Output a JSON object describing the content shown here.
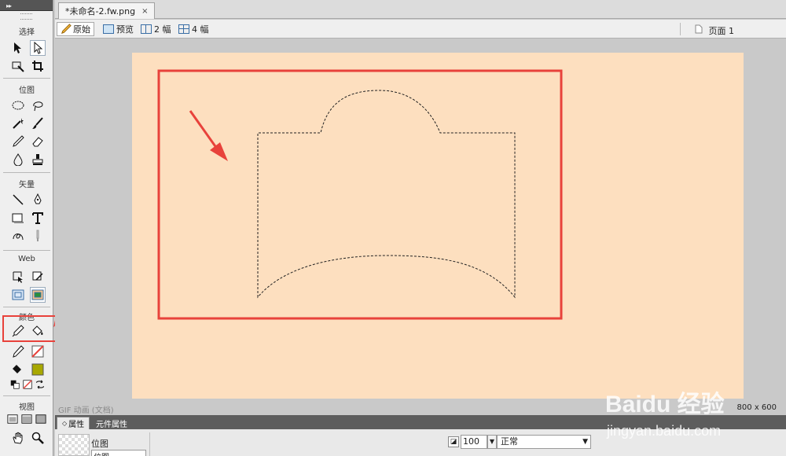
{
  "document": {
    "tab_title": "*未命名-2.fw.png",
    "close_glyph": "×"
  },
  "view_bar": {
    "original": "原始",
    "preview": "预览",
    "two_up": "2 幅",
    "four_up": "4 幅",
    "page": "页面 1"
  },
  "toolbar": {
    "sections": {
      "select": "选择",
      "bitmap": "位图",
      "vector": "矢量",
      "web": "Web",
      "colors": "颜色",
      "view": "视图"
    },
    "stroke_color": "#e8423b",
    "fill_color": "#a8a800"
  },
  "status": {
    "left": "GIF 动画 (文档)",
    "size": "800 x 600"
  },
  "properties": {
    "tabs": [
      "属性",
      "元件属性"
    ],
    "object_type": "位图",
    "object_name": "位图",
    "opacity": "100",
    "blend_mode": "正常"
  },
  "watermark": {
    "brand": "Baidu 经验",
    "url": "jingyan.baidu.com"
  },
  "colors": {
    "canvas": "#fddfbf",
    "highlight": "#e8423b",
    "annotation_arrow": "#e8423b"
  }
}
